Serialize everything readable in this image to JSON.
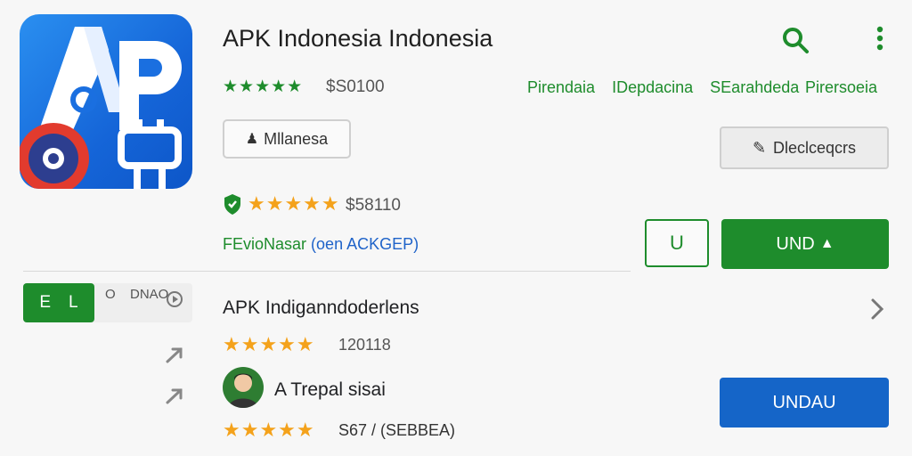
{
  "app": {
    "title": "APK Indonesia Indonesia",
    "rating_stars": "★★★★★",
    "price": "$S0100",
    "icon_letters": "AP"
  },
  "header_links": [
    "Pirendaia",
    "IDepdacina",
    "SEarahdeda",
    "Pirersoeia"
  ],
  "secondary_button": {
    "label": "Mllanesa",
    "icon": "person-icon"
  },
  "right_button": {
    "label": "Dleclceqcrs",
    "icon": "edit-icon"
  },
  "rating_row": {
    "stars": "★★★★★",
    "price": "$58110"
  },
  "info_line": {
    "green_text": "FEvioNasar",
    "blue_text": "(oen ACKGEP)"
  },
  "buttons": {
    "square_symbol": "U",
    "install_label": "UND",
    "install_icon": "upload-icon",
    "second_install_label": "UNDAU"
  },
  "badge": {
    "letter_e": "E",
    "letter_l": "L",
    "small_text": "O",
    "meta": "DNAO"
  },
  "list": [
    {
      "title": "APK Indiganndoderlens",
      "stars": "★★★★★",
      "meta": "120118"
    },
    {
      "title": "A Trepal sisai",
      "stars": "★★★★★",
      "meta": "S67 / (SEBBEA)"
    }
  ],
  "colors": {
    "accent_green": "#1e8c2c",
    "accent_blue": "#1565c8",
    "star_orange": "#f4a21b",
    "icon_blue": "#1a6fe0"
  }
}
